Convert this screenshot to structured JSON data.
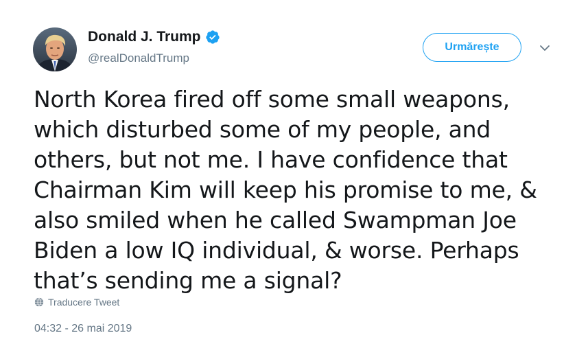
{
  "author": {
    "display_name": "Donald J. Trump",
    "handle": "@realDonaldTrump",
    "verified": true
  },
  "actions": {
    "follow_label": "Urmărește",
    "menu_icon": "chevron-down-icon"
  },
  "tweet": {
    "text": "North Korea fired off some small weapons,\nwhich disturbed some of my people, and\nothers, but not me. I have confidence that\nChairman Kim will keep his promise to me, &\nalso smiled when he called Swampman Joe\nBiden a low IQ individual, & worse. Perhaps\nthat’s sending me a signal?",
    "translate_label": "Traducere Tweet",
    "timestamp": "04:32 - 26 mai 2019"
  },
  "colors": {
    "accent": "#1da1f2",
    "secondary_text": "#657786",
    "primary_text": "#14171a"
  }
}
